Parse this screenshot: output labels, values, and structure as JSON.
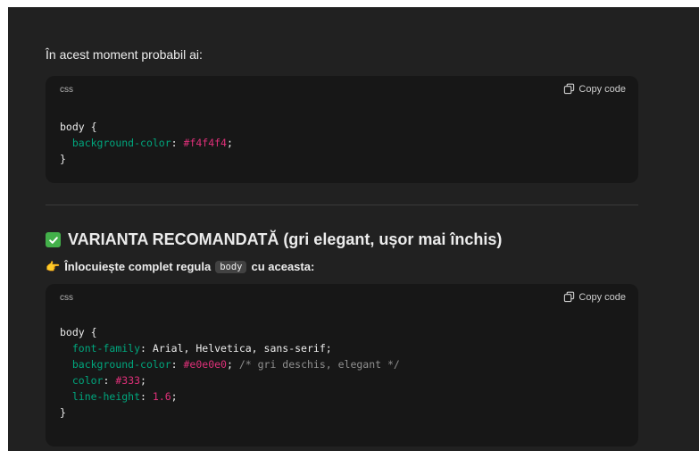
{
  "intro_text": "În acest moment probabil ai:",
  "code_blocks": [
    {
      "lang": "css",
      "copy_label": "Copy code",
      "lines": [
        {
          "selector": "body {"
        },
        {
          "prop": "background-color",
          "value": "#f4f4f4"
        },
        {
          "close": "}"
        }
      ]
    },
    {
      "lang": "css",
      "copy_label": "Copy code",
      "lines": [
        {
          "selector": "body {"
        },
        {
          "prop": "font-family",
          "value": "Arial, Helvetica, sans-serif"
        },
        {
          "prop": "background-color",
          "value": "#e0e0e0",
          "comment": "/* gri deschis, elegant */"
        },
        {
          "prop": "color",
          "value": "#333"
        },
        {
          "prop": "line-height",
          "value": "1.6"
        },
        {
          "close": "}"
        }
      ]
    }
  ],
  "section": {
    "heading": "VARIANTA RECOMANDATĂ (gri elegant, ușor mai închis)",
    "instruction_before": "Înlocuiește complet regula",
    "instruction_code": "body",
    "instruction_after": "cu aceasta:"
  },
  "colors": {
    "background": "#212121",
    "code_background": "#171717",
    "accent_check": "#43b04a",
    "prop_color": "#00a67d",
    "value_color": "#df3079"
  },
  "icons": {
    "copy": "copy-icon",
    "check": "check-icon",
    "hand": "pointing-hand-icon"
  }
}
